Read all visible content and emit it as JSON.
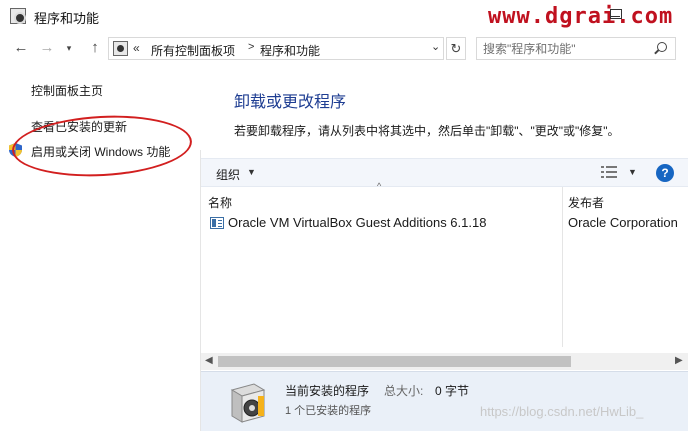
{
  "window": {
    "title": "程序和功能",
    "overlay_watermark": "www.dgrai.com"
  },
  "navigation": {
    "back_icon": "arrow-left-icon",
    "forward_icon": "arrow-right-icon",
    "recent_icon": "chevron-down-icon",
    "up_icon": "arrow-up-icon",
    "address": {
      "overflow": "«",
      "crumb1": "所有控制面板项",
      "crumb_separator": ">",
      "crumb2": "程序和功能"
    },
    "search_placeholder": "搜索\"程序和功能\""
  },
  "sidebar": {
    "items": [
      {
        "label": "控制面板主页"
      },
      {
        "label": "查看已安装的更新"
      },
      {
        "label": "启用或关闭 Windows 功能"
      }
    ]
  },
  "main": {
    "heading": "卸载或更改程序",
    "instruction": "若要卸载程序，请从列表中将其选中，然后单击\"卸载\"、\"更改\"或\"修复\"。",
    "toolbar": {
      "organize_label": "组织",
      "help_label": "?"
    },
    "columns": {
      "name": "名称",
      "publisher": "发布者"
    },
    "rows": [
      {
        "name": "Oracle VM VirtualBox Guest Additions 6.1.18",
        "publisher": "Oracle Corporation"
      }
    ],
    "details": {
      "title": "当前安装的程序",
      "size_label": "总大小:",
      "size_value": "0 字节",
      "count": "1 个已安装的程序"
    },
    "watermark": "https://blog.csdn.net/HwLib_"
  },
  "colors": {
    "heading": "#1e3d92",
    "annotation_circle": "#d21f1f",
    "details_bg": "#eaf0f8"
  }
}
